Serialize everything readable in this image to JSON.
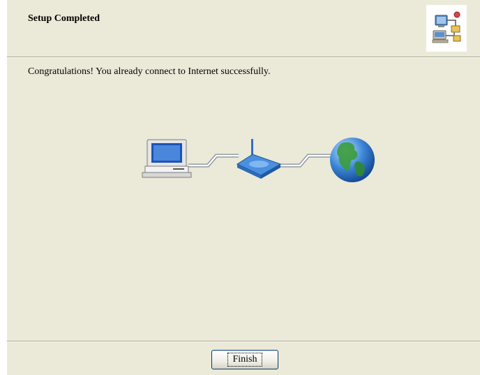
{
  "header": {
    "title": "Setup Completed",
    "icon": "network-wizard-icon"
  },
  "main": {
    "message": "Congratulations! You already connect to Internet successfully.",
    "diagram": {
      "icons": [
        "computer-icon",
        "router-icon",
        "globe-icon"
      ]
    }
  },
  "footer": {
    "finish_label": "Finish"
  },
  "colors": {
    "window_bg": "#ebe9d8",
    "outer_bg": "#ffffff",
    "button_border": "#003c74"
  }
}
